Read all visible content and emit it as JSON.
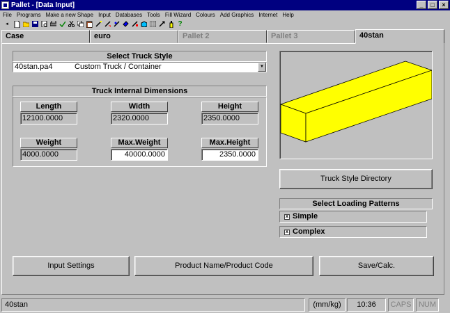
{
  "window": {
    "title": "Pallet - [Data Input]",
    "buttons": {
      "minimize": "_",
      "maximize": "□",
      "close": "×"
    }
  },
  "menu": [
    "File",
    "Programs",
    "Make a new Shape",
    "Input",
    "Databases",
    "Tools",
    "Fill Wizard",
    "Colours",
    "Add Graphics",
    "Internet",
    "Help"
  ],
  "toolbar": {
    "back_label": "back"
  },
  "tabs": [
    "Case",
    "euro",
    "Pallet 2",
    "Pallet 3",
    "40stan"
  ],
  "truck_style": {
    "header": "Select Truck Style",
    "selected_file": "40stan.pa4",
    "selected_name": "Custom Truck / Container",
    "drop_arrow": "▼"
  },
  "dimensions": {
    "header": "Truck Internal Dimensions",
    "length_label": "Length",
    "length_value": "12100.0000",
    "width_label": "Width",
    "width_value": "2320.0000",
    "height_label": "Height",
    "height_value": "2350.0000",
    "weight_label": "Weight",
    "weight_value": "4000.0000",
    "max_weight_label": "Max.Weight",
    "max_weight_value": "40000.0000",
    "max_height_label": "Max.Height",
    "max_height_value": "2350.0000"
  },
  "preview": {
    "box_color": "#ffff00"
  },
  "truck_dir_button": "Truck Style Directory",
  "loading": {
    "header": "Select Loading Patterns",
    "check_mark": "x",
    "simple_label": "Simple",
    "complex_label": "Complex"
  },
  "buttons": {
    "input_settings": "Input Settings",
    "product_name": "Product Name/Product Code",
    "save_calc": "Save/Calc."
  },
  "status": {
    "file": "40stan",
    "units": "(mm/kg)",
    "time": "10:36",
    "caps": "CAPS",
    "num": "NUM"
  }
}
